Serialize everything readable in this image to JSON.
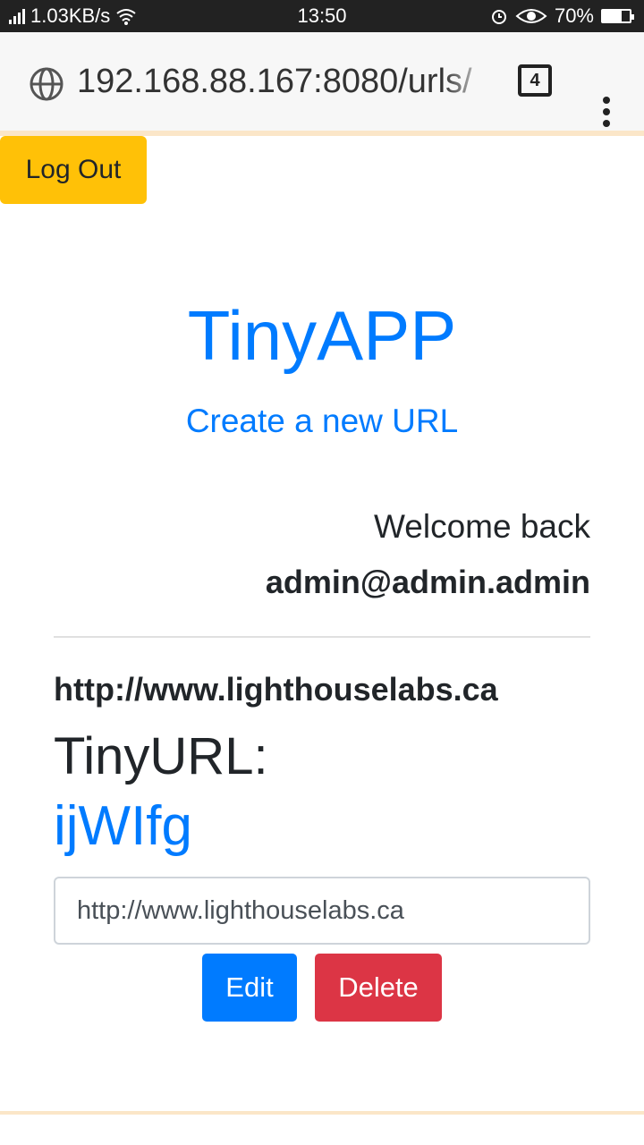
{
  "status_bar": {
    "net_speed": "1.03KB/s",
    "time": "13:50",
    "battery": "70%",
    "battery_level": 0.7
  },
  "browser": {
    "url": "192.168.88.167:8080/urls/",
    "tab_count": "4"
  },
  "header": {
    "logout_label": "Log Out"
  },
  "main": {
    "title": "TinyAPP",
    "create_link": "Create a new URL",
    "welcome": "Welcome back",
    "user_email": "admin@admin.admin"
  },
  "urls": [
    {
      "long_url": "http://www.lighthouselabs.ca",
      "tiny_label": "TinyURL:",
      "short_code": "ijWIfg",
      "input_value": "http://www.lighthouselabs.ca",
      "edit_label": "Edit",
      "delete_label": "Delete"
    }
  ],
  "colors": {
    "primary": "#007bff",
    "warning": "#ffc107",
    "danger": "#dc3545"
  },
  "icons": [
    "signal-icon",
    "wifi-icon",
    "alarm-icon",
    "eye-icon",
    "battery-icon",
    "globe-icon",
    "tabs-icon",
    "more-vert-icon"
  ]
}
